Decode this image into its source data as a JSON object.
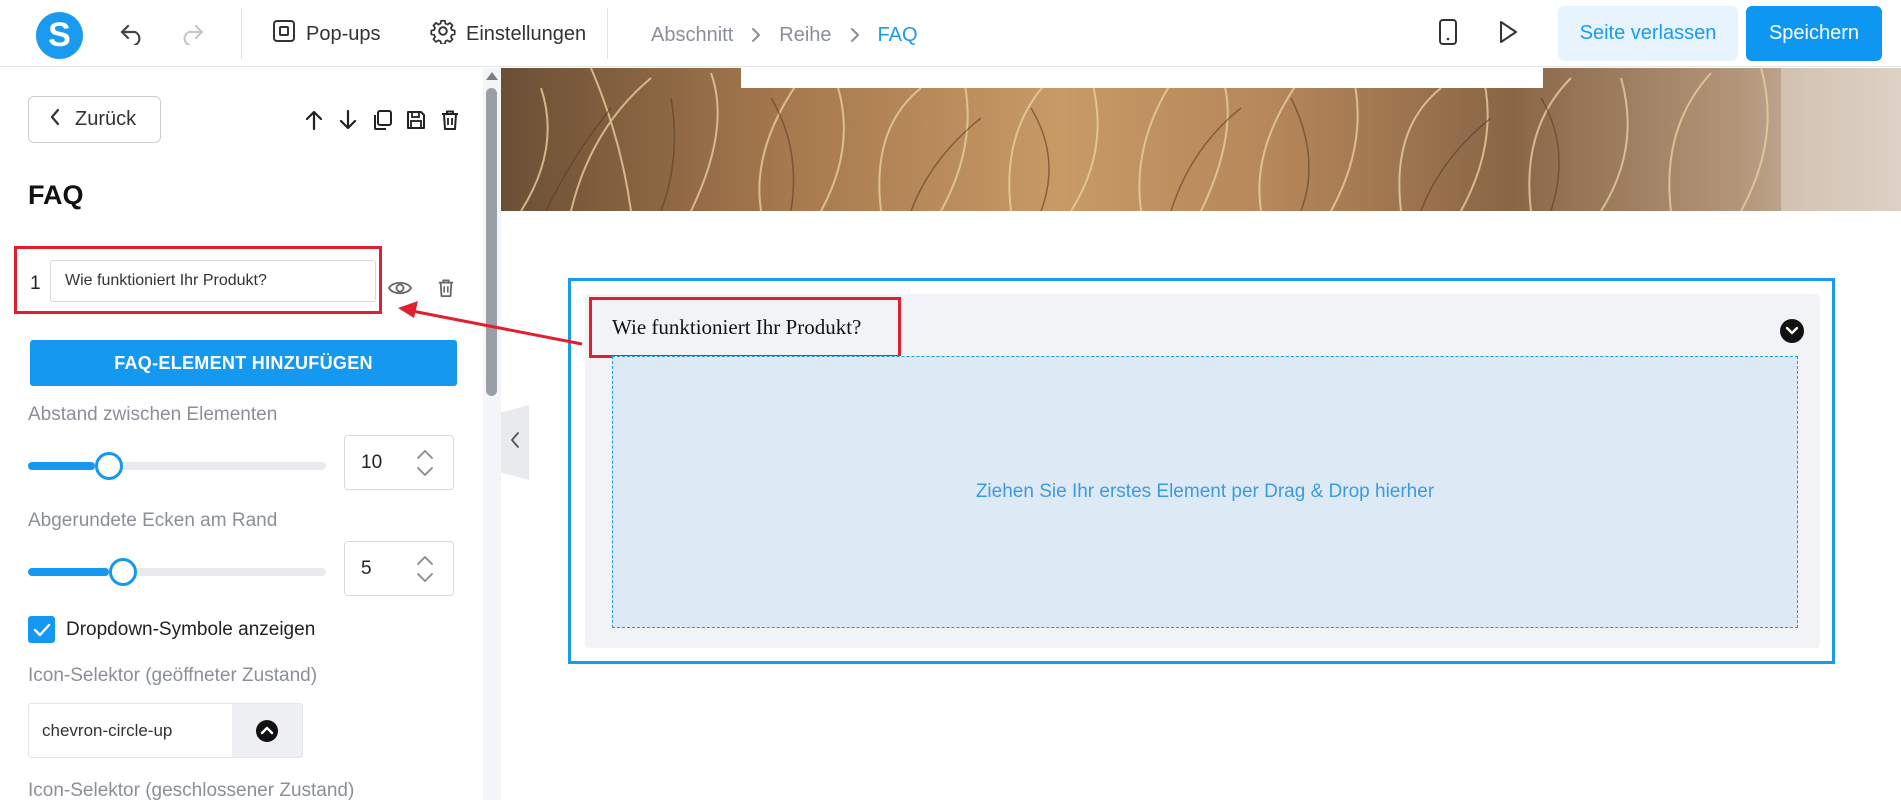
{
  "topbar": {
    "logo_letter": "S",
    "popups_label": "Pop-ups",
    "settings_label": "Einstellungen",
    "breadcrumb": [
      "Abschnitt",
      "Reihe",
      "FAQ"
    ],
    "leave_label": "Seite verlassen",
    "save_label": "Speichern"
  },
  "panel": {
    "back_label": "Zurück",
    "title": "FAQ",
    "faq_items": [
      {
        "number": "1",
        "question": "Wie funktioniert Ihr Produkt?"
      }
    ],
    "add_label": "FAQ-ELEMENT HINZUFÜGEN",
    "spacing": {
      "label": "Abstand zwischen Elementen",
      "value": "10",
      "slider_fraction": 0.23
    },
    "radius": {
      "label": "Abgerundete Ecken am Rand",
      "value": "5",
      "slider_fraction": 0.27
    },
    "show_dropdown_icons": {
      "label": "Dropdown-Symbole anzeigen",
      "checked": true
    },
    "icon_open": {
      "label": "Icon-Selektor (geöffneter Zustand)",
      "value": "chevron-circle-up"
    },
    "icon_closed": {
      "label": "Icon-Selektor (geschlossener Zustand)"
    }
  },
  "canvas": {
    "faq_question": "Wie funktioniert Ihr Produkt?",
    "drop_zone_text": "Ziehen Sie Ihr erstes Element per Drag & Drop hierher"
  },
  "colors": {
    "accent": "#1a9bf0",
    "highlight": "#e0202f",
    "drop_zone": "#ddeaf6"
  }
}
